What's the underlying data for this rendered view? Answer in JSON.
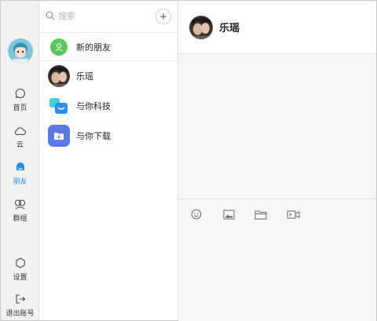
{
  "sidebar": {
    "items": [
      {
        "label": "首页",
        "icon": "chat-bubble-icon"
      },
      {
        "label": "云",
        "icon": "cloud-icon"
      },
      {
        "label": "朋友",
        "icon": "friends-icon"
      },
      {
        "label": "群组",
        "icon": "group-icon"
      }
    ],
    "bottom": [
      {
        "label": "设置",
        "icon": "settings-hexagon-icon"
      },
      {
        "label": "退出账号",
        "icon": "logout-icon"
      }
    ],
    "active_index": 2
  },
  "search": {
    "placeholder": "搜索"
  },
  "contacts": [
    {
      "name": "新的朋友",
      "icon": "new-friend-icon"
    },
    {
      "name": "乐瑶",
      "icon": "photo-avatar"
    },
    {
      "name": "与你科技",
      "icon": "company-logo-icon"
    },
    {
      "name": "与你下载",
      "icon": "download-folder-icon"
    }
  ],
  "chat": {
    "title": "乐瑶"
  },
  "toolbar": {
    "tools": [
      "emoji-icon",
      "image-icon",
      "folder-icon",
      "video-icon"
    ]
  },
  "colors": {
    "accent": "#1e8ef7",
    "new_friend_green": "#5cc75a",
    "download_purple": "#5b78e6",
    "tech_blue": "#2b8ff5",
    "tech_cyan": "#3fd1d9"
  }
}
